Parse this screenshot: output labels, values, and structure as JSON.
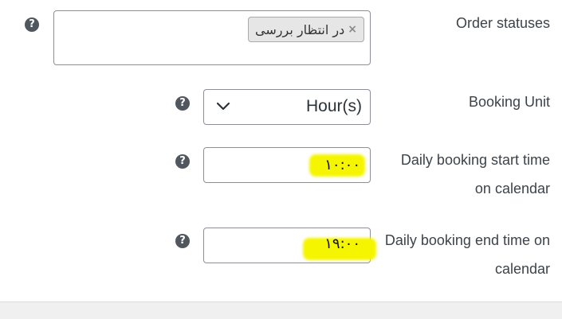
{
  "order_statuses": {
    "label": "Order statuses",
    "help_icon": "?",
    "selected_tag": "در انتظار بررسی",
    "tag_remove_glyph": "×"
  },
  "booking_unit": {
    "label": "Booking Unit",
    "help_icon": "?",
    "value": "Hour(s)"
  },
  "start_time": {
    "label_line1": "Daily booking start time",
    "label_line2": "on calendar",
    "help_icon": "?",
    "value": "۱۰:۰۰"
  },
  "end_time": {
    "label_line1": "Daily booking end time on",
    "label_line2": "calendar",
    "help_icon": "?",
    "value": "۱۹:۰۰"
  },
  "colors": {
    "highlight": "#f5f500",
    "help_icon_bg": "#50575e",
    "border": "#8c8f94"
  }
}
